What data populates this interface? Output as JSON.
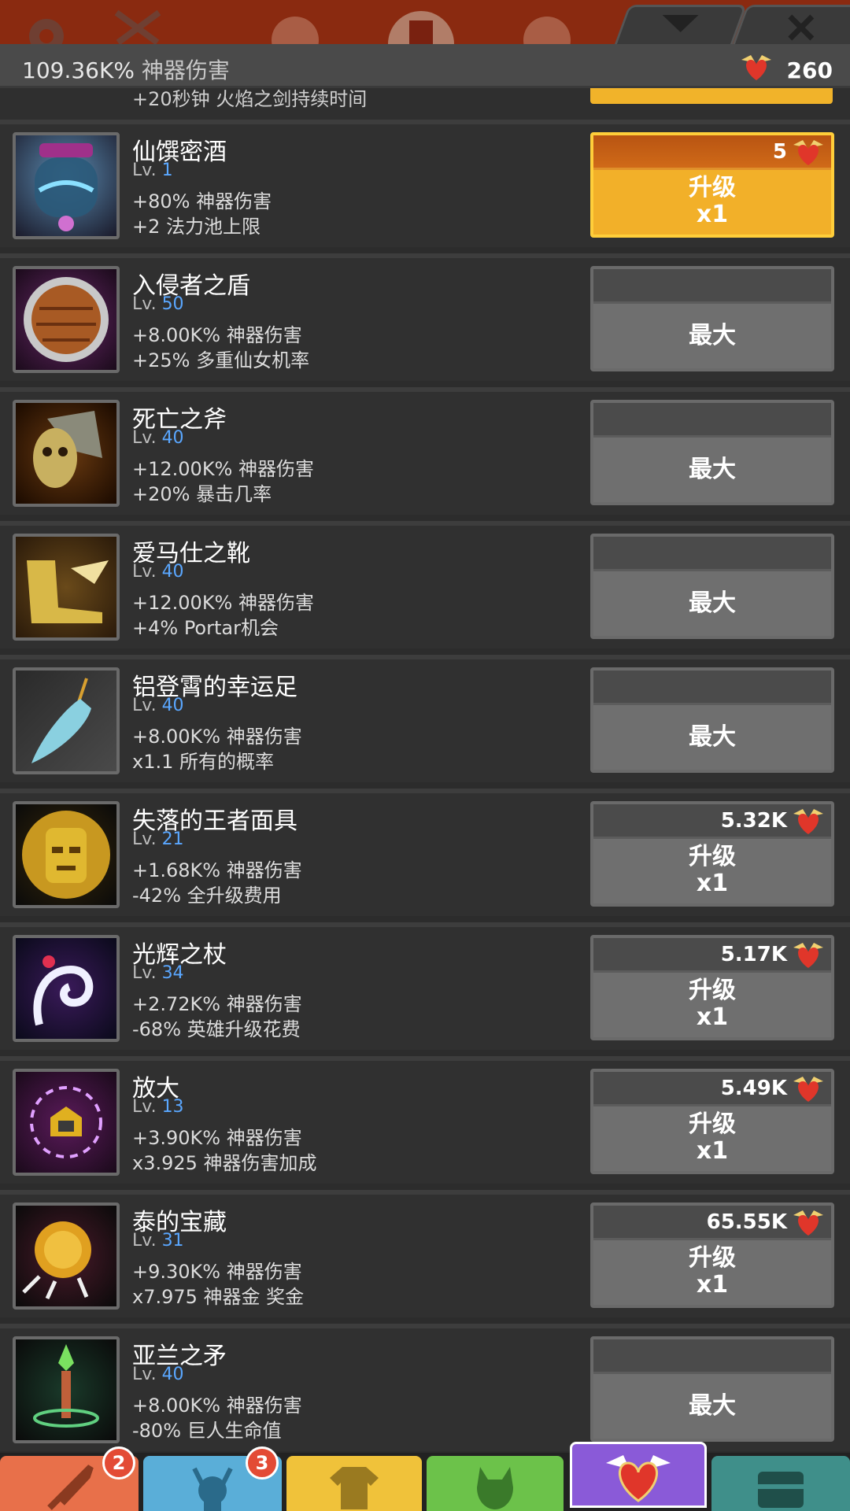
{
  "header": {
    "total_damage_value": "109.36K%",
    "total_damage_label": "神器伤害",
    "relic_count": "260"
  },
  "partial_row": {
    "effect": "+20秒钟 火焰之剑持续时间"
  },
  "artifacts": [
    {
      "name": "仙馔密酒",
      "level_label": "Lv.",
      "level": "1",
      "effect1": "+80% 神器伤害",
      "effect2": "+2 法力池上限",
      "cost": "5",
      "action": "升级",
      "multiplier": "x1",
      "state": "gold"
    },
    {
      "name": "入侵者之盾",
      "level_label": "Lv.",
      "level": "50",
      "effect1": "+8.00K% 神器伤害",
      "effect2": "+25% 多重仙女机率",
      "cost": "",
      "action": "最大",
      "multiplier": "",
      "state": "max"
    },
    {
      "name": "死亡之斧",
      "level_label": "Lv.",
      "level": "40",
      "effect1": "+12.00K% 神器伤害",
      "effect2": "+20% 暴击几率",
      "cost": "",
      "action": "最大",
      "multiplier": "",
      "state": "max"
    },
    {
      "name": "爱马仕之靴",
      "level_label": "Lv.",
      "level": "40",
      "effect1": "+12.00K% 神器伤害",
      "effect2": "+4% Portar机会",
      "cost": "",
      "action": "最大",
      "multiplier": "",
      "state": "max"
    },
    {
      "name": "铝登霄的幸运足",
      "level_label": "Lv.",
      "level": "40",
      "effect1": "+8.00K% 神器伤害",
      "effect2": "x1.1 所有的概率",
      "cost": "",
      "action": "最大",
      "multiplier": "",
      "state": "max"
    },
    {
      "name": "失落的王者面具",
      "level_label": "Lv.",
      "level": "21",
      "effect1": "+1.68K% 神器伤害",
      "effect2": "-42% 全升级费用",
      "cost": "5.32K",
      "action": "升级",
      "multiplier": "x1",
      "state": "grey"
    },
    {
      "name": "光辉之杖",
      "level_label": "Lv.",
      "level": "34",
      "effect1": "+2.72K% 神器伤害",
      "effect2": "-68% 英雄升级花费",
      "cost": "5.17K",
      "action": "升级",
      "multiplier": "x1",
      "state": "grey"
    },
    {
      "name": "放大",
      "level_label": "Lv.",
      "level": "13",
      "effect1": "+3.90K% 神器伤害",
      "effect2": "x3.925 神器伤害加成",
      "cost": "5.49K",
      "action": "升级",
      "multiplier": "x1",
      "state": "grey"
    },
    {
      "name": " 泰的宝藏",
      "level_label": "Lv.",
      "level": "31",
      "effect1": "+9.30K% 神器伤害",
      "effect2": "x7.975 神器金 奖金",
      "cost": "65.55K",
      "action": "升级",
      "multiplier": "x1",
      "state": "grey"
    },
    {
      "name": "亚兰之矛",
      "level_label": "Lv.",
      "level": "40",
      "effect1": "+8.00K% 神器伤害",
      "effect2": "-80% 巨人生命值",
      "cost": "",
      "action": "最大",
      "multiplier": "",
      "state": "max"
    }
  ],
  "tabs": [
    {
      "name": "sword",
      "badge": "2",
      "color": "#e8704a"
    },
    {
      "name": "hero",
      "badge": "3",
      "color": "#5aaed8"
    },
    {
      "name": "equipment",
      "badge": "",
      "color": "#f0c23a"
    },
    {
      "name": "pet",
      "badge": "",
      "color": "#6cc24a"
    },
    {
      "name": "artifacts",
      "badge": "",
      "color": "#8a5ad8"
    },
    {
      "name": "shop",
      "badge": "",
      "color": "#3f8f8a"
    }
  ]
}
